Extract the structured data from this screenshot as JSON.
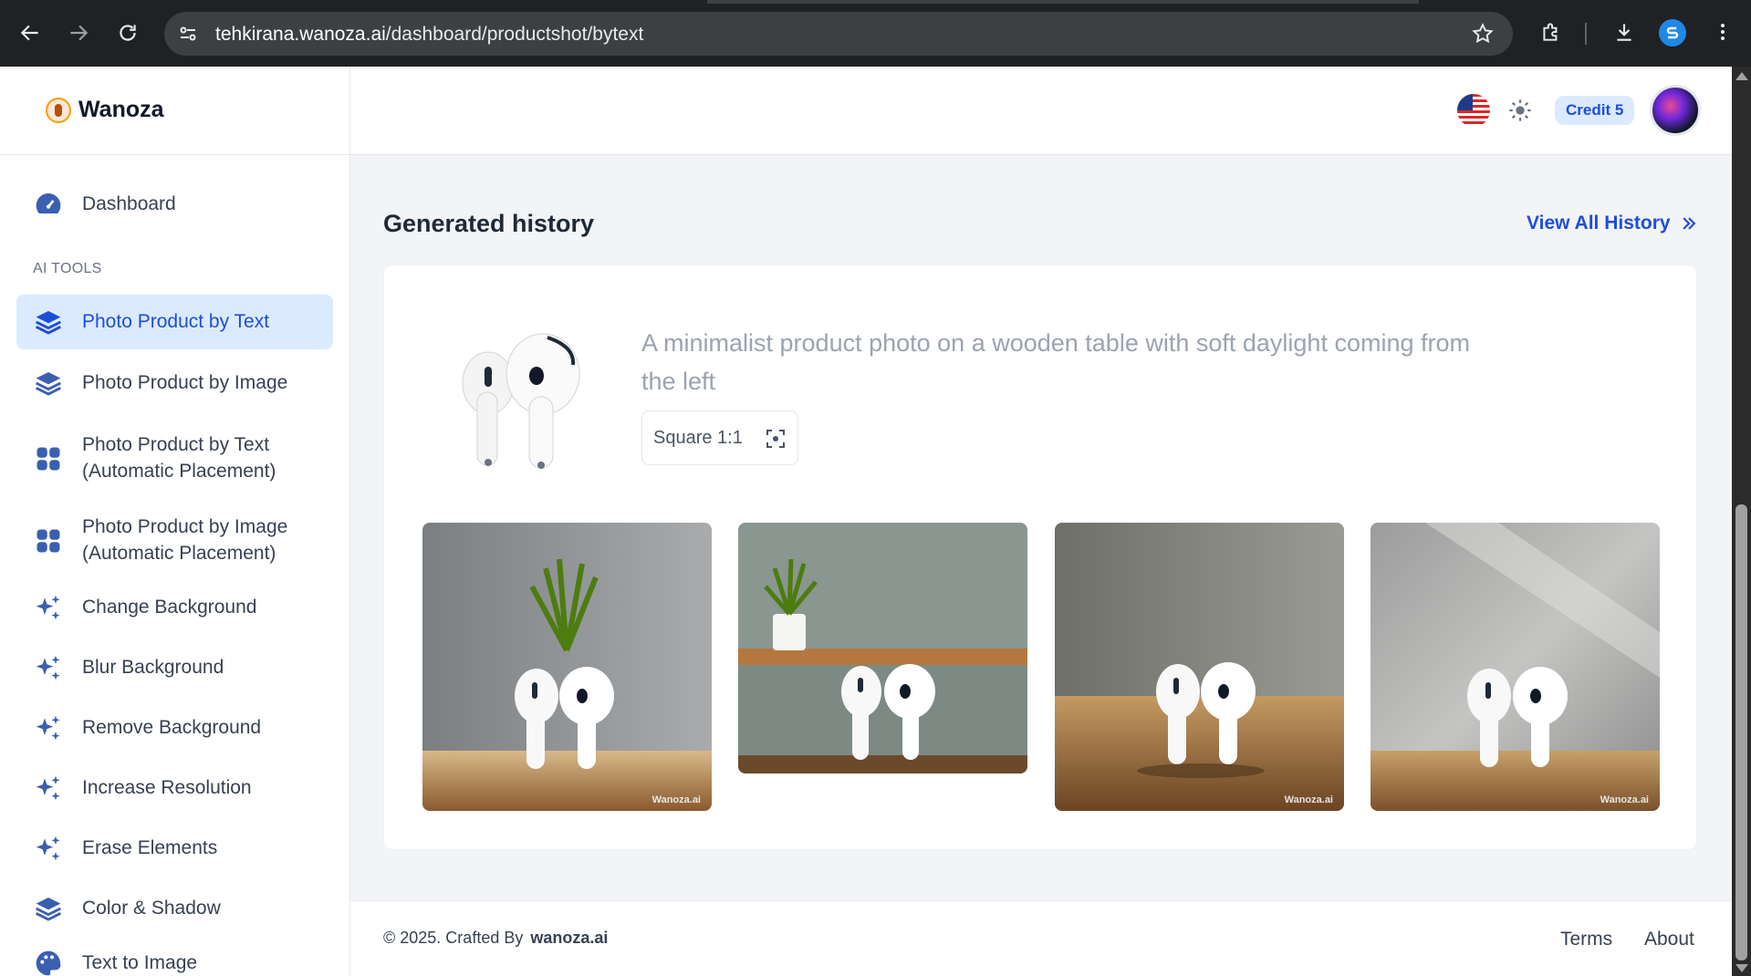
{
  "browser": {
    "url_host": "tehkirana.wanoza.ai",
    "url_path": "/dashboard/productshot/bytext"
  },
  "brand": {
    "name": "Wanoza"
  },
  "sidebar": {
    "dashboard_label": "Dashboard",
    "section_label": "AI TOOLS",
    "items": [
      {
        "label": "Photo Product by Text",
        "icon": "layers-icon",
        "active": true
      },
      {
        "label": "Photo Product by Image",
        "icon": "layers-icon"
      },
      {
        "label": "Photo Product by Text (Automatic Placement)",
        "icon": "grid-icon"
      },
      {
        "label": "Photo Product by Image (Automatic Placement)",
        "icon": "grid-icon"
      },
      {
        "label": "Change Background",
        "icon": "sparkles-icon"
      },
      {
        "label": "Blur Background",
        "icon": "sparkles-icon"
      },
      {
        "label": "Remove Background",
        "icon": "sparkles-icon"
      },
      {
        "label": "Increase Resolution",
        "icon": "sparkles-icon"
      },
      {
        "label": "Erase Elements",
        "icon": "sparkles-icon"
      },
      {
        "label": "Color & Shadow",
        "icon": "layers-icon"
      },
      {
        "label": "Text to Image",
        "icon": "palette-icon"
      }
    ]
  },
  "header": {
    "credit_label": "Credit 5"
  },
  "main": {
    "title": "Generated history",
    "view_all_label": "View All History",
    "history": {
      "prompt": "A minimalist product photo on a wooden table with soft daylight coming from the left",
      "ratio_label": "Square 1:1",
      "watermark": "Wanoza.ai"
    }
  },
  "footer": {
    "copyright": "© 2025. Crafted By",
    "brand_link": "wanoza.ai",
    "terms_label": "Terms",
    "about_label": "About"
  },
  "colors": {
    "accent": "#1d4ed8",
    "accent_bg": "#dbeafe",
    "sidebar_icon": "#3b5fb0"
  }
}
